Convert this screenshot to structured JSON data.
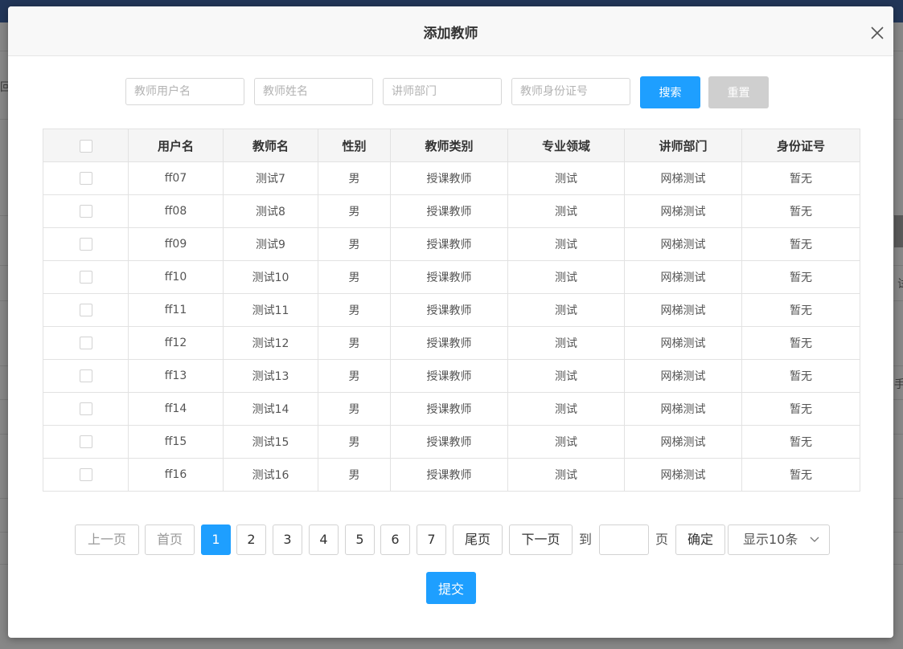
{
  "background": {
    "left_fragments": [
      "回"
    ],
    "right_fragments": [
      "试",
      "手"
    ]
  },
  "modal": {
    "title": "添加教师"
  },
  "search": {
    "username_placeholder": "教师用户名",
    "name_placeholder": "教师姓名",
    "dept_placeholder": "讲师部门",
    "idcard_placeholder": "教师身份证号",
    "search_label": "搜索",
    "reset_label": "重置"
  },
  "table": {
    "headers": [
      "用户名",
      "教师名",
      "性别",
      "教师类别",
      "专业领域",
      "讲师部门",
      "身份证号"
    ],
    "rows": [
      [
        "ff07",
        "测试7",
        "男",
        "授课教师",
        "测试",
        "网梯测试",
        "暂无"
      ],
      [
        "ff08",
        "测试8",
        "男",
        "授课教师",
        "测试",
        "网梯测试",
        "暂无"
      ],
      [
        "ff09",
        "测试9",
        "男",
        "授课教师",
        "测试",
        "网梯测试",
        "暂无"
      ],
      [
        "ff10",
        "测试10",
        "男",
        "授课教师",
        "测试",
        "网梯测试",
        "暂无"
      ],
      [
        "ff11",
        "测试11",
        "男",
        "授课教师",
        "测试",
        "网梯测试",
        "暂无"
      ],
      [
        "ff12",
        "测试12",
        "男",
        "授课教师",
        "测试",
        "网梯测试",
        "暂无"
      ],
      [
        "ff13",
        "测试13",
        "男",
        "授课教师",
        "测试",
        "网梯测试",
        "暂无"
      ],
      [
        "ff14",
        "测试14",
        "男",
        "授课教师",
        "测试",
        "网梯测试",
        "暂无"
      ],
      [
        "ff15",
        "测试15",
        "男",
        "授课教师",
        "测试",
        "网梯测试",
        "暂无"
      ],
      [
        "ff16",
        "测试16",
        "男",
        "授课教师",
        "测试",
        "网梯测试",
        "暂无"
      ]
    ]
  },
  "pagination": {
    "prev": "上一页",
    "first": "首页",
    "pages": [
      "1",
      "2",
      "3",
      "4",
      "5",
      "6",
      "7"
    ],
    "current_page": "1",
    "last": "尾页",
    "next": "下一页",
    "goto_label": "到",
    "page_unit": "页",
    "goto_value": "",
    "confirm": "确定",
    "page_size": "显示10条"
  },
  "submit_label": "提交",
  "colors": {
    "primary": "#1e9fff",
    "disabled": "#cfcfcf",
    "header_bg": "#f8f8f8"
  },
  "icons": {
    "close": "close-icon",
    "dropdown": "chevron-down-icon"
  }
}
